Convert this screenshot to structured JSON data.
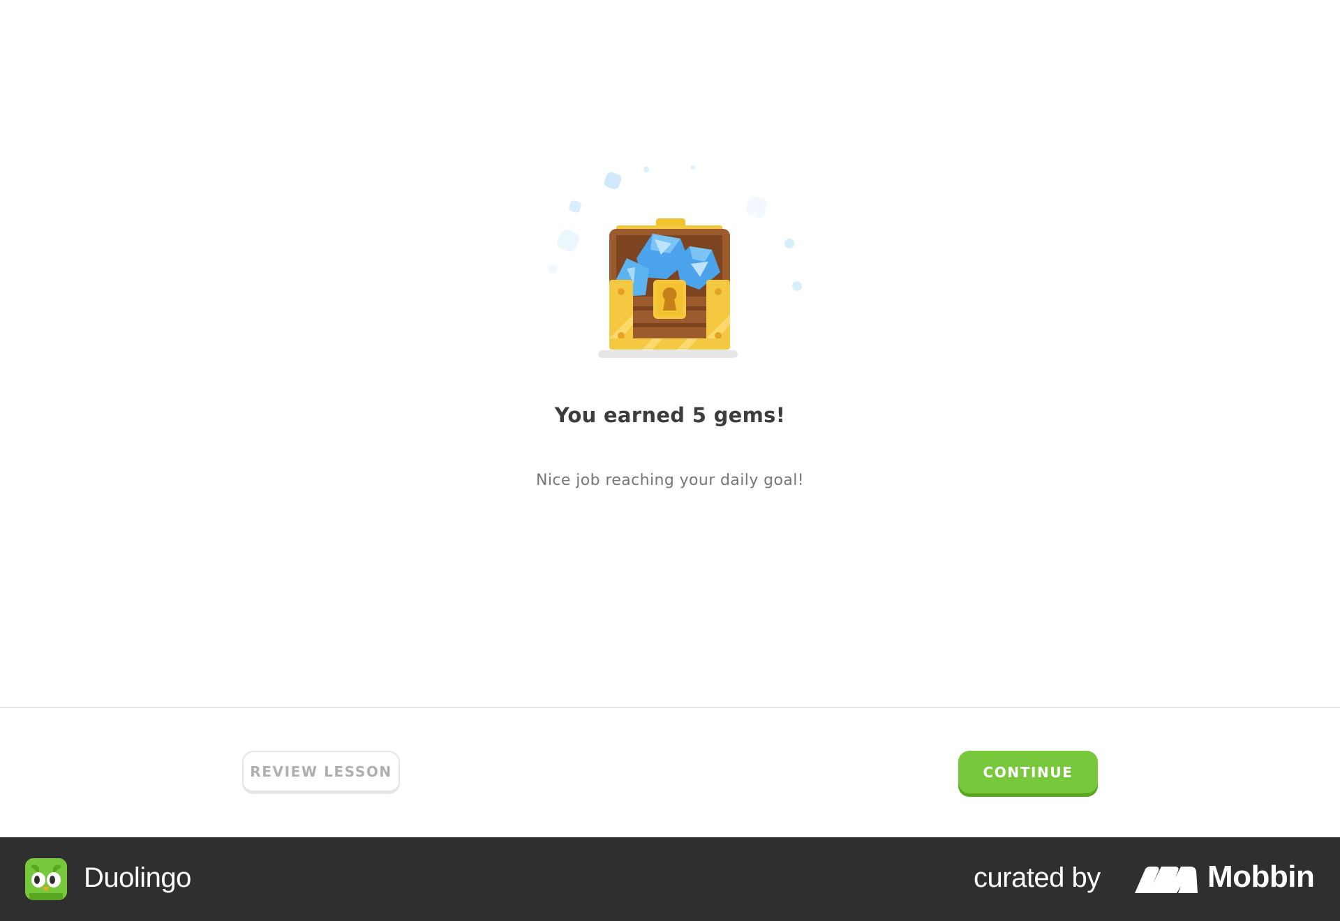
{
  "reward": {
    "title": "You earned 5 gems!",
    "subtitle": "Nice job reaching your daily goal!"
  },
  "actions": {
    "review_label": "REVIEW LESSON",
    "continue_label": "CONTINUE"
  },
  "branding": {
    "app_name": "Duolingo",
    "curated_by": "curated by",
    "curator": "Mobbin"
  },
  "colors": {
    "continue_button": "#78c83c",
    "gem": "#5bb3f0",
    "chest_gold": "#f5c842",
    "chest_wood": "#9b5b2d"
  },
  "icons": {
    "chest": "treasure-chest-icon",
    "app": "duolingo-owl-icon",
    "curator": "mobbin-logo-icon"
  }
}
